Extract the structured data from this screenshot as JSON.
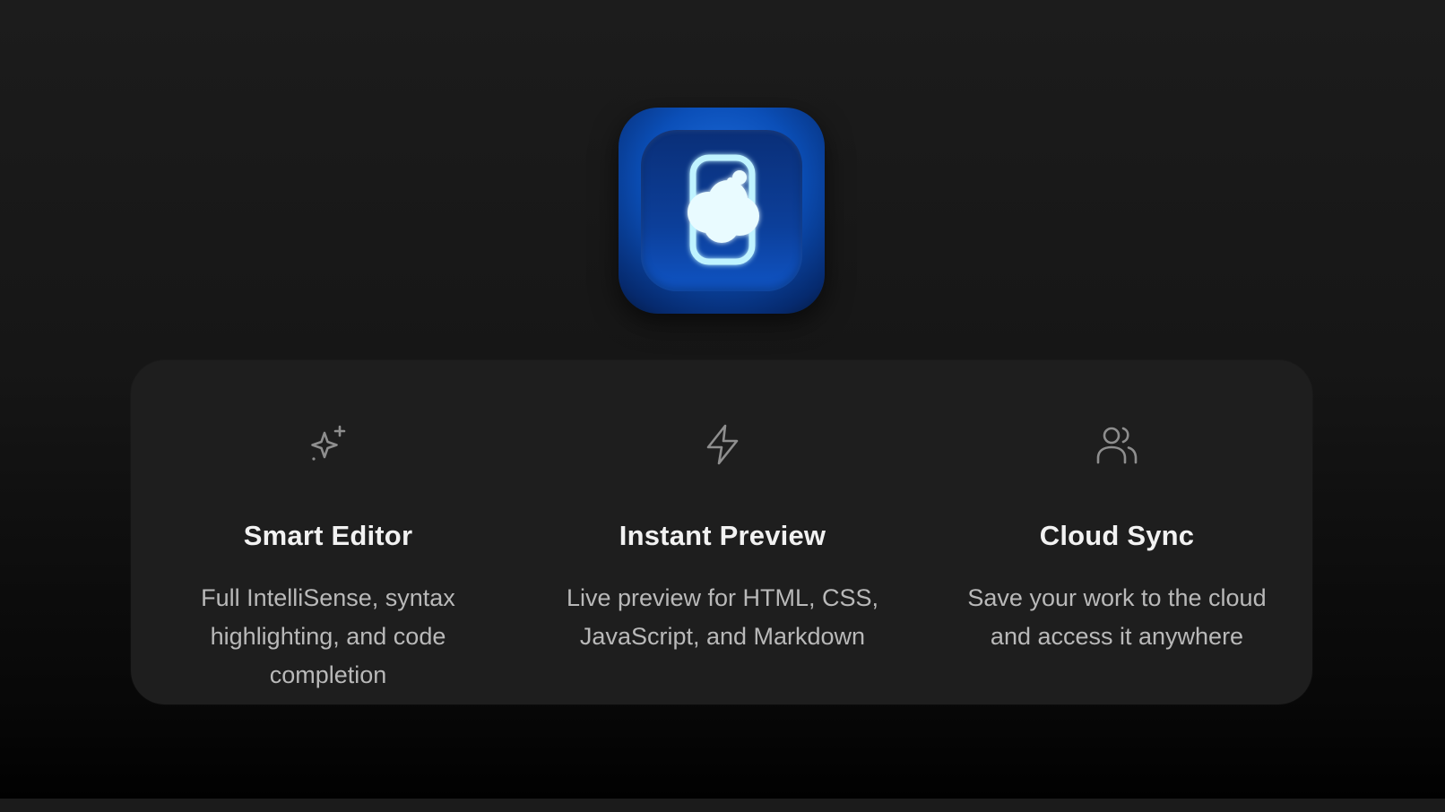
{
  "app": {
    "icon_name": "cloud-phone-app-icon",
    "accent_color": "#0b4fb8"
  },
  "features": [
    {
      "icon": "sparkles-icon",
      "title": "Smart Editor",
      "description": "Full IntelliSense, syntax highlighting, and code completion"
    },
    {
      "icon": "lightning-bolt-icon",
      "title": "Instant Preview",
      "description": "Live preview for HTML, CSS, JavaScript, and Markdown"
    },
    {
      "icon": "users-icon",
      "title": "Cloud Sync",
      "description": "Save your work to the cloud and access it anywhere"
    }
  ]
}
